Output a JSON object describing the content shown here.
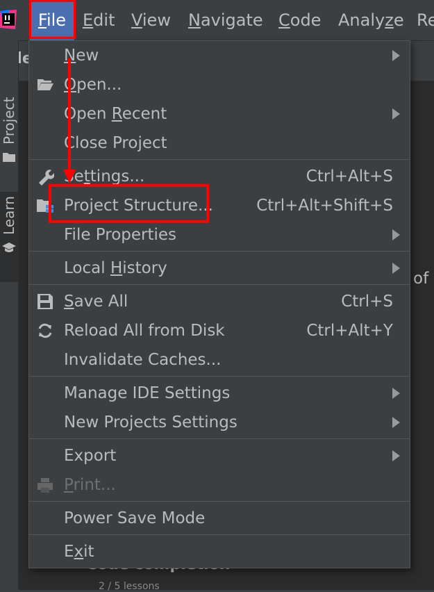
{
  "menubar": {
    "items": [
      {
        "pre": "",
        "u": "F",
        "post": "ile"
      },
      {
        "pre": "",
        "u": "E",
        "post": "dit"
      },
      {
        "pre": "",
        "u": "V",
        "post": "iew"
      },
      {
        "pre": "",
        "u": "N",
        "post": "avigate"
      },
      {
        "pre": "",
        "u": "C",
        "post": "ode"
      },
      {
        "pre": "Analy",
        "u": "z",
        "post": "e"
      },
      {
        "pre": "Re",
        "u": "",
        "post": ""
      }
    ]
  },
  "background": {
    "project_title_fragment": "Ide",
    "project_tab": "Project",
    "learn_tab": "Learn",
    "side_text_fragment": "of",
    "bottom_chevron": "›",
    "bottom_text": "Code completion",
    "bottom_subtext": "2 / 5 lessons"
  },
  "file_menu": {
    "new": {
      "pre": "",
      "u": "N",
      "post": "ew"
    },
    "open": {
      "pre": "",
      "u": "O",
      "post": "pen..."
    },
    "open_recent": {
      "pre": "Open ",
      "u": "R",
      "post": "ecent"
    },
    "close_project": {
      "pre": "",
      "u": "",
      "post": "Close Project"
    },
    "settings": {
      "pre": "Se",
      "u": "t",
      "post": "tings...",
      "shortcut": "Ctrl+Alt+S"
    },
    "project_structure": {
      "pre": "Project Structure...",
      "u": "",
      "post": "",
      "shortcut": "Ctrl+Alt+Shift+S"
    },
    "file_properties": {
      "pre": "File Properties",
      "u": "",
      "post": ""
    },
    "local_history": {
      "pre": "Local ",
      "u": "H",
      "post": "istory"
    },
    "save_all": {
      "pre": "",
      "u": "S",
      "post": "ave All",
      "shortcut": "Ctrl+S"
    },
    "reload": {
      "pre": "Reload All from Disk",
      "u": "",
      "post": "",
      "shortcut": "Ctrl+Alt+Y"
    },
    "invalidate": {
      "pre": "Invalidate Caches...",
      "u": "",
      "post": ""
    },
    "manage_ide": {
      "pre": "Manage IDE Settings",
      "u": "",
      "post": ""
    },
    "new_projects": {
      "pre": "New Projects Settings",
      "u": "",
      "post": ""
    },
    "export": {
      "pre": "Export",
      "u": "",
      "post": ""
    },
    "print": {
      "pre": "",
      "u": "P",
      "post": "rint..."
    },
    "power_save": {
      "pre": "Power Save Mode",
      "u": "",
      "post": ""
    },
    "exit": {
      "pre": "E",
      "u": "x",
      "post": "it"
    }
  },
  "colors": {
    "menu_bg": "#3c3f41",
    "selection": "#4b6eaf",
    "annotation": "#ff0000"
  }
}
